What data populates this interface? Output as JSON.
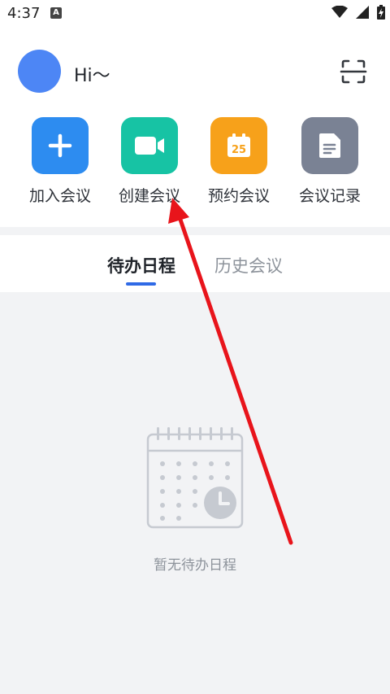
{
  "status_bar": {
    "time": "4:37",
    "notification_letter": "A",
    "icons": [
      "wifi-icon",
      "signal-icon",
      "battery-charging-icon"
    ]
  },
  "header": {
    "greeting": "Hi～",
    "scan_icon": "scan-icon"
  },
  "actions": [
    {
      "label": "加入会议",
      "icon": "plus-icon",
      "color": "#2d8cf0"
    },
    {
      "label": "创建会议",
      "icon": "video-camera-icon",
      "color": "#17c3a4"
    },
    {
      "label": "预约会议",
      "icon": "calendar-icon",
      "color": "#f7a11a",
      "icon_text": "25"
    },
    {
      "label": "会议记录",
      "icon": "document-icon",
      "color": "#7a8294"
    }
  ],
  "tabs": [
    {
      "label": "待办日程",
      "active": true
    },
    {
      "label": "历史会议",
      "active": false
    }
  ],
  "empty_state": {
    "icon": "calendar-clock-icon",
    "text": "暂无待办日程"
  },
  "colors": {
    "accent": "#2f6ae6",
    "annotation_arrow": "#e8141b"
  }
}
